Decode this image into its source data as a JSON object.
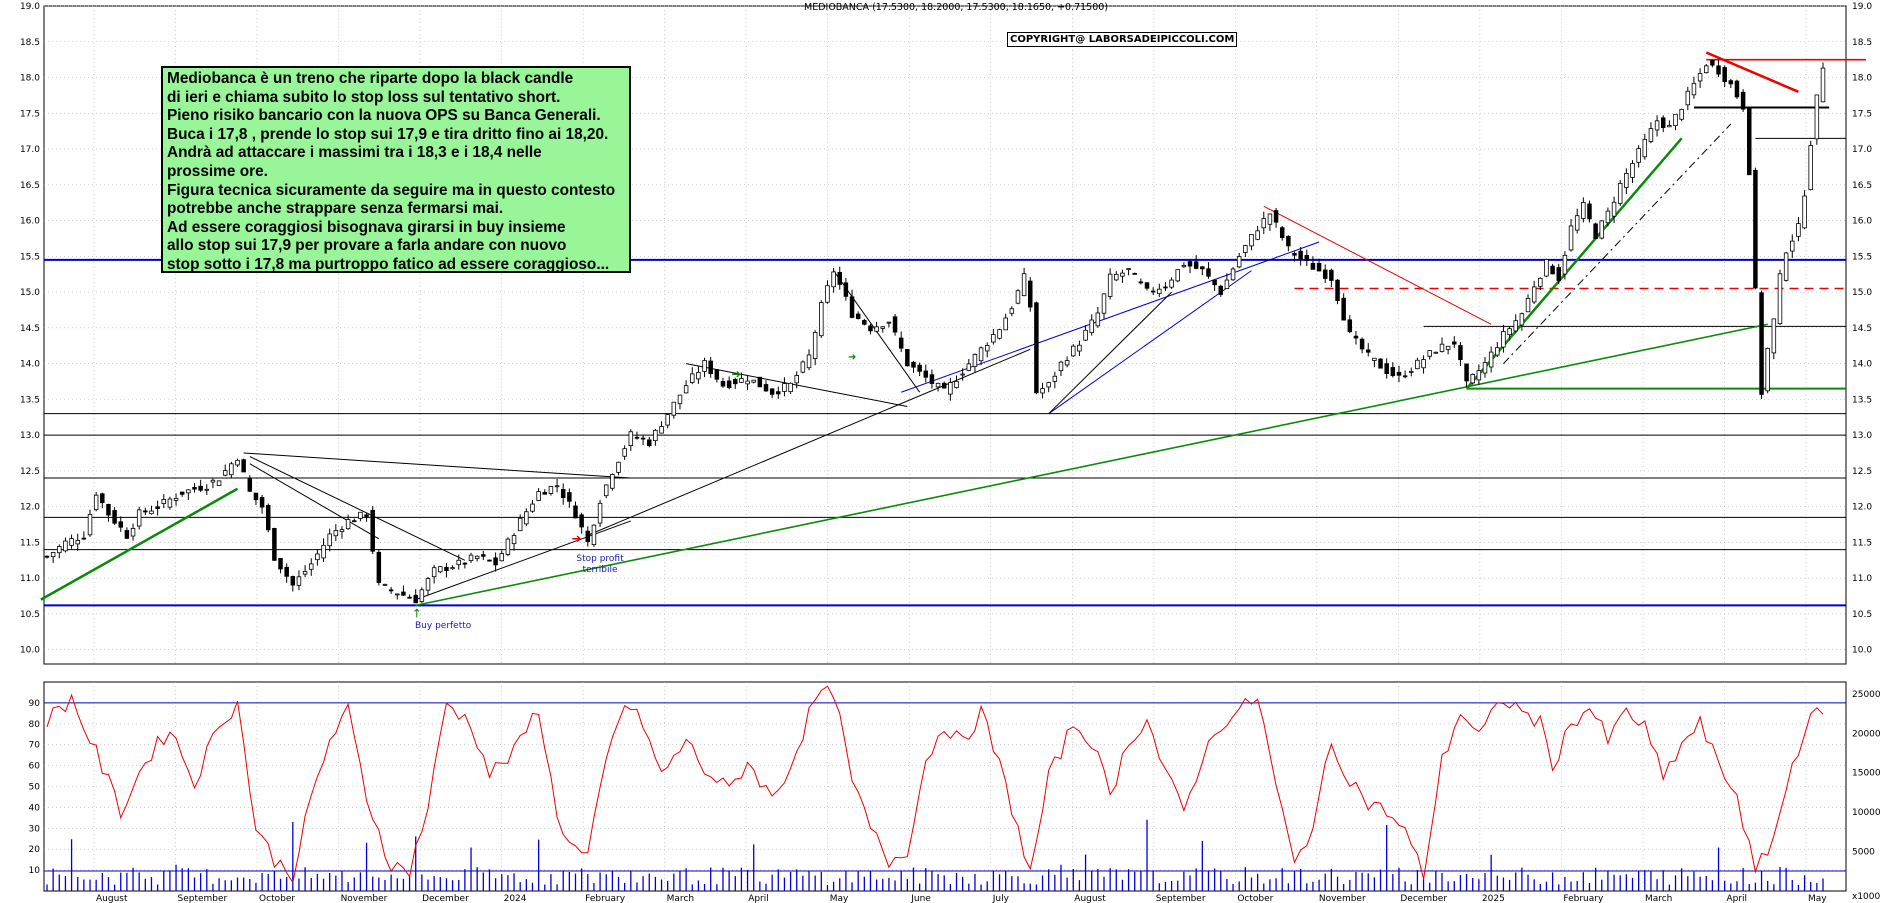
{
  "chart_data": [
    {
      "type": "candlestick",
      "title": "MEDIOBANCA (17.5300, 18.2000, 17.5300, 18.1650, +0.71500)",
      "watermark": "COPYRIGHT@ LABORSADEIPICCOLI.COM",
      "ylim": [
        9.8,
        19.0
      ],
      "y_ticks": [
        "10.0",
        "10.5",
        "11.0",
        "11.5",
        "12.0",
        "12.5",
        "13.0",
        "13.5",
        "14.0",
        "14.5",
        "15.0",
        "15.5",
        "16.0",
        "16.5",
        "17.0",
        "17.5",
        "18.0",
        "18.5",
        "19.0"
      ],
      "x_labels": [
        "August",
        "September",
        "October",
        "November",
        "December",
        "2024",
        "February",
        "March",
        "April",
        "May",
        "June",
        "July",
        "August",
        "September",
        "October",
        "November",
        "December",
        "2025",
        "February",
        "March",
        "April",
        "May"
      ],
      "price_path": [
        [
          0,
          11.3
        ],
        [
          3,
          11.5
        ],
        [
          6,
          11.6
        ],
        [
          8,
          12.2
        ],
        [
          10,
          11.9
        ],
        [
          13,
          11.6
        ],
        [
          15,
          11.9
        ],
        [
          18,
          12.0
        ],
        [
          22,
          12.2
        ],
        [
          26,
          12.3
        ],
        [
          28,
          12.4
        ],
        [
          31,
          12.7
        ],
        [
          33,
          12.2
        ],
        [
          35,
          12.0
        ],
        [
          37,
          11.3
        ],
        [
          40,
          10.9
        ],
        [
          43,
          11.2
        ],
        [
          46,
          11.6
        ],
        [
          49,
          11.8
        ],
        [
          52,
          11.9
        ],
        [
          54,
          10.9
        ],
        [
          57,
          10.8
        ],
        [
          60,
          10.7
        ],
        [
          63,
          11.1
        ],
        [
          67,
          11.2
        ],
        [
          70,
          11.3
        ],
        [
          73,
          11.2
        ],
        [
          77,
          11.8
        ],
        [
          80,
          12.2
        ],
        [
          83,
          12.3
        ],
        [
          86,
          11.9
        ],
        [
          88,
          11.5
        ],
        [
          90,
          12.1
        ],
        [
          92,
          12.5
        ],
        [
          95,
          13.0
        ],
        [
          98,
          12.9
        ],
        [
          101,
          13.3
        ],
        [
          104,
          13.7
        ],
        [
          107,
          14.0
        ],
        [
          110,
          13.7
        ],
        [
          114,
          13.8
        ],
        [
          118,
          13.6
        ],
        [
          121,
          13.7
        ],
        [
          124,
          14.1
        ],
        [
          126,
          14.8
        ],
        [
          128,
          15.3
        ],
        [
          131,
          14.7
        ],
        [
          134,
          14.5
        ],
        [
          137,
          14.6
        ],
        [
          140,
          14.0
        ],
        [
          143,
          13.8
        ],
        [
          146,
          13.6
        ],
        [
          149,
          13.9
        ],
        [
          152,
          14.2
        ],
        [
          155,
          14.5
        ],
        [
          157,
          14.8
        ],
        [
          159,
          15.2
        ],
        [
          160,
          14.8
        ],
        [
          161,
          13.6
        ],
        [
          163,
          13.7
        ],
        [
          165,
          14.0
        ],
        [
          168,
          14.3
        ],
        [
          171,
          14.7
        ],
        [
          173,
          15.2
        ],
        [
          176,
          15.3
        ],
        [
          179,
          15.0
        ],
        [
          182,
          15.1
        ],
        [
          185,
          15.4
        ],
        [
          188,
          15.3
        ],
        [
          191,
          15.0
        ],
        [
          194,
          15.5
        ],
        [
          197,
          15.9
        ],
        [
          199,
          16.1
        ],
        [
          202,
          15.6
        ],
        [
          205,
          15.4
        ],
        [
          207,
          15.3
        ],
        [
          209,
          15.2
        ],
        [
          212,
          14.4
        ],
        [
          215,
          14.1
        ],
        [
          218,
          13.9
        ],
        [
          220,
          13.8
        ],
        [
          223,
          14.0
        ],
        [
          226,
          14.2
        ],
        [
          229,
          14.3
        ],
        [
          231,
          13.7
        ],
        [
          234,
          14.0
        ],
        [
          237,
          14.4
        ],
        [
          240,
          14.7
        ],
        [
          242,
          15.1
        ],
        [
          244,
          15.4
        ],
        [
          246,
          15.2
        ],
        [
          248,
          15.9
        ],
        [
          250,
          16.2
        ],
        [
          252,
          15.8
        ],
        [
          254,
          16.1
        ],
        [
          256,
          16.5
        ],
        [
          258,
          16.8
        ],
        [
          260,
          17.1
        ],
        [
          262,
          17.4
        ],
        [
          264,
          17.3
        ],
        [
          266,
          17.6
        ],
        [
          268,
          17.9
        ],
        [
          270,
          18.2
        ],
        [
          272,
          18.1
        ],
        [
          274,
          17.9
        ],
        [
          276,
          17.6
        ],
        [
          277,
          16.7
        ],
        [
          278,
          15.0
        ],
        [
          279,
          13.6
        ],
        [
          280,
          14.2
        ],
        [
          281,
          14.6
        ],
        [
          282,
          15.2
        ],
        [
          283,
          15.6
        ],
        [
          285,
          15.9
        ],
        [
          286,
          16.4
        ],
        [
          287,
          17.1
        ],
        [
          288,
          17.7
        ],
        [
          289,
          18.17
        ]
      ],
      "trendlines": [
        "blue support 15.45",
        "blue support 10.62",
        "red dashed 15.05",
        "green support 13.65",
        "red resistance 18.25",
        "black support 17.58",
        "black support 17.15"
      ],
      "annotations": [
        "Buy perfetto",
        "Stop profit terribile"
      ]
    },
    {
      "type": "line",
      "name": "lower oscillator (0-100) with volume bars",
      "ylim": [
        0,
        100
      ],
      "left_ticks": [
        "10",
        "20",
        "30",
        "40",
        "50",
        "60",
        "70",
        "80",
        "90"
      ],
      "right_ticks": [
        "5000",
        "10000",
        "15000",
        "20000",
        "25000"
      ],
      "right_scale_label": "x1000",
      "reference_line": 90,
      "oscillator_path": [
        [
          0,
          82
        ],
        [
          4,
          92
        ],
        [
          8,
          66
        ],
        [
          12,
          38
        ],
        [
          16,
          62
        ],
        [
          20,
          78
        ],
        [
          24,
          52
        ],
        [
          28,
          80
        ],
        [
          31,
          90
        ],
        [
          34,
          30
        ],
        [
          37,
          15
        ],
        [
          40,
          8
        ],
        [
          43,
          44
        ],
        [
          46,
          72
        ],
        [
          49,
          86
        ],
        [
          52,
          45
        ],
        [
          56,
          12
        ],
        [
          59,
          10
        ],
        [
          62,
          40
        ],
        [
          65,
          90
        ],
        [
          69,
          80
        ],
        [
          72,
          56
        ],
        [
          76,
          66
        ],
        [
          80,
          88
        ],
        [
          83,
          35
        ],
        [
          86,
          20
        ],
        [
          88,
          16
        ],
        [
          91,
          62
        ],
        [
          94,
          90
        ],
        [
          97,
          80
        ],
        [
          100,
          55
        ],
        [
          104,
          72
        ],
        [
          107,
          58
        ],
        [
          111,
          48
        ],
        [
          114,
          62
        ],
        [
          118,
          44
        ],
        [
          121,
          60
        ],
        [
          125,
          92
        ],
        [
          128,
          96
        ],
        [
          131,
          52
        ],
        [
          134,
          30
        ],
        [
          137,
          14
        ],
        [
          140,
          20
        ],
        [
          143,
          62
        ],
        [
          146,
          80
        ],
        [
          149,
          70
        ],
        [
          152,
          86
        ],
        [
          155,
          60
        ],
        [
          158,
          30
        ],
        [
          160,
          8
        ],
        [
          163,
          54
        ],
        [
          167,
          80
        ],
        [
          170,
          72
        ],
        [
          173,
          46
        ],
        [
          176,
          72
        ],
        [
          179,
          82
        ],
        [
          182,
          56
        ],
        [
          185,
          38
        ],
        [
          188,
          64
        ],
        [
          191,
          80
        ],
        [
          194,
          86
        ],
        [
          197,
          93
        ],
        [
          200,
          50
        ],
        [
          203,
          12
        ],
        [
          206,
          32
        ],
        [
          209,
          70
        ],
        [
          212,
          54
        ],
        [
          215,
          42
        ],
        [
          218,
          38
        ],
        [
          221,
          28
        ],
        [
          224,
          8
        ],
        [
          227,
          62
        ],
        [
          230,
          86
        ],
        [
          233,
          74
        ],
        [
          237,
          92
        ],
        [
          240,
          86
        ],
        [
          243,
          80
        ],
        [
          245,
          60
        ],
        [
          248,
          80
        ],
        [
          251,
          88
        ],
        [
          254,
          72
        ],
        [
          257,
          86
        ],
        [
          260,
          78
        ],
        [
          263,
          54
        ],
        [
          266,
          70
        ],
        [
          269,
          80
        ],
        [
          272,
          60
        ],
        [
          275,
          46
        ],
        [
          278,
          8
        ],
        [
          281,
          26
        ],
        [
          284,
          60
        ],
        [
          287,
          86
        ],
        [
          289,
          82
        ]
      ]
    }
  ],
  "note": {
    "lines": [
      "Mediobanca è un treno che riparte dopo la black candle",
      "di ieri e chiama subito lo stop loss sul tentativo short.",
      "Pieno risiko bancario con la nuova OPS su Banca Generali.",
      "Buca i 17,8 , prende lo stop sui 17,9 e tira dritto  fino ai 18,20.",
      "Andrà ad attaccare i massimi tra i 18,3 e i 18,4 nelle",
      "prossime ore.",
      "Figura tecnica sicuramente da seguire ma in questo contesto",
      "potrebbe anche strappare senza fermarsi mai.",
      "Ad essere coraggiosi bisognava girarsi in buy insieme",
      "allo stop sui 17,9 per provare a farla andare con nuovo",
      "stop sotto i 17,8 ma purtroppo fatico ad essere coraggioso..."
    ]
  },
  "colors": {
    "up_candle": "#ffffff",
    "down_candle": "#000000",
    "grid": "#b0b0b0",
    "support": "#0000cc",
    "trend_green": "#0a8a0a",
    "trend_red": "#ee0000",
    "oscillator": "#ee0000",
    "volume": "#0000dd",
    "note_bg": "#98f598"
  }
}
